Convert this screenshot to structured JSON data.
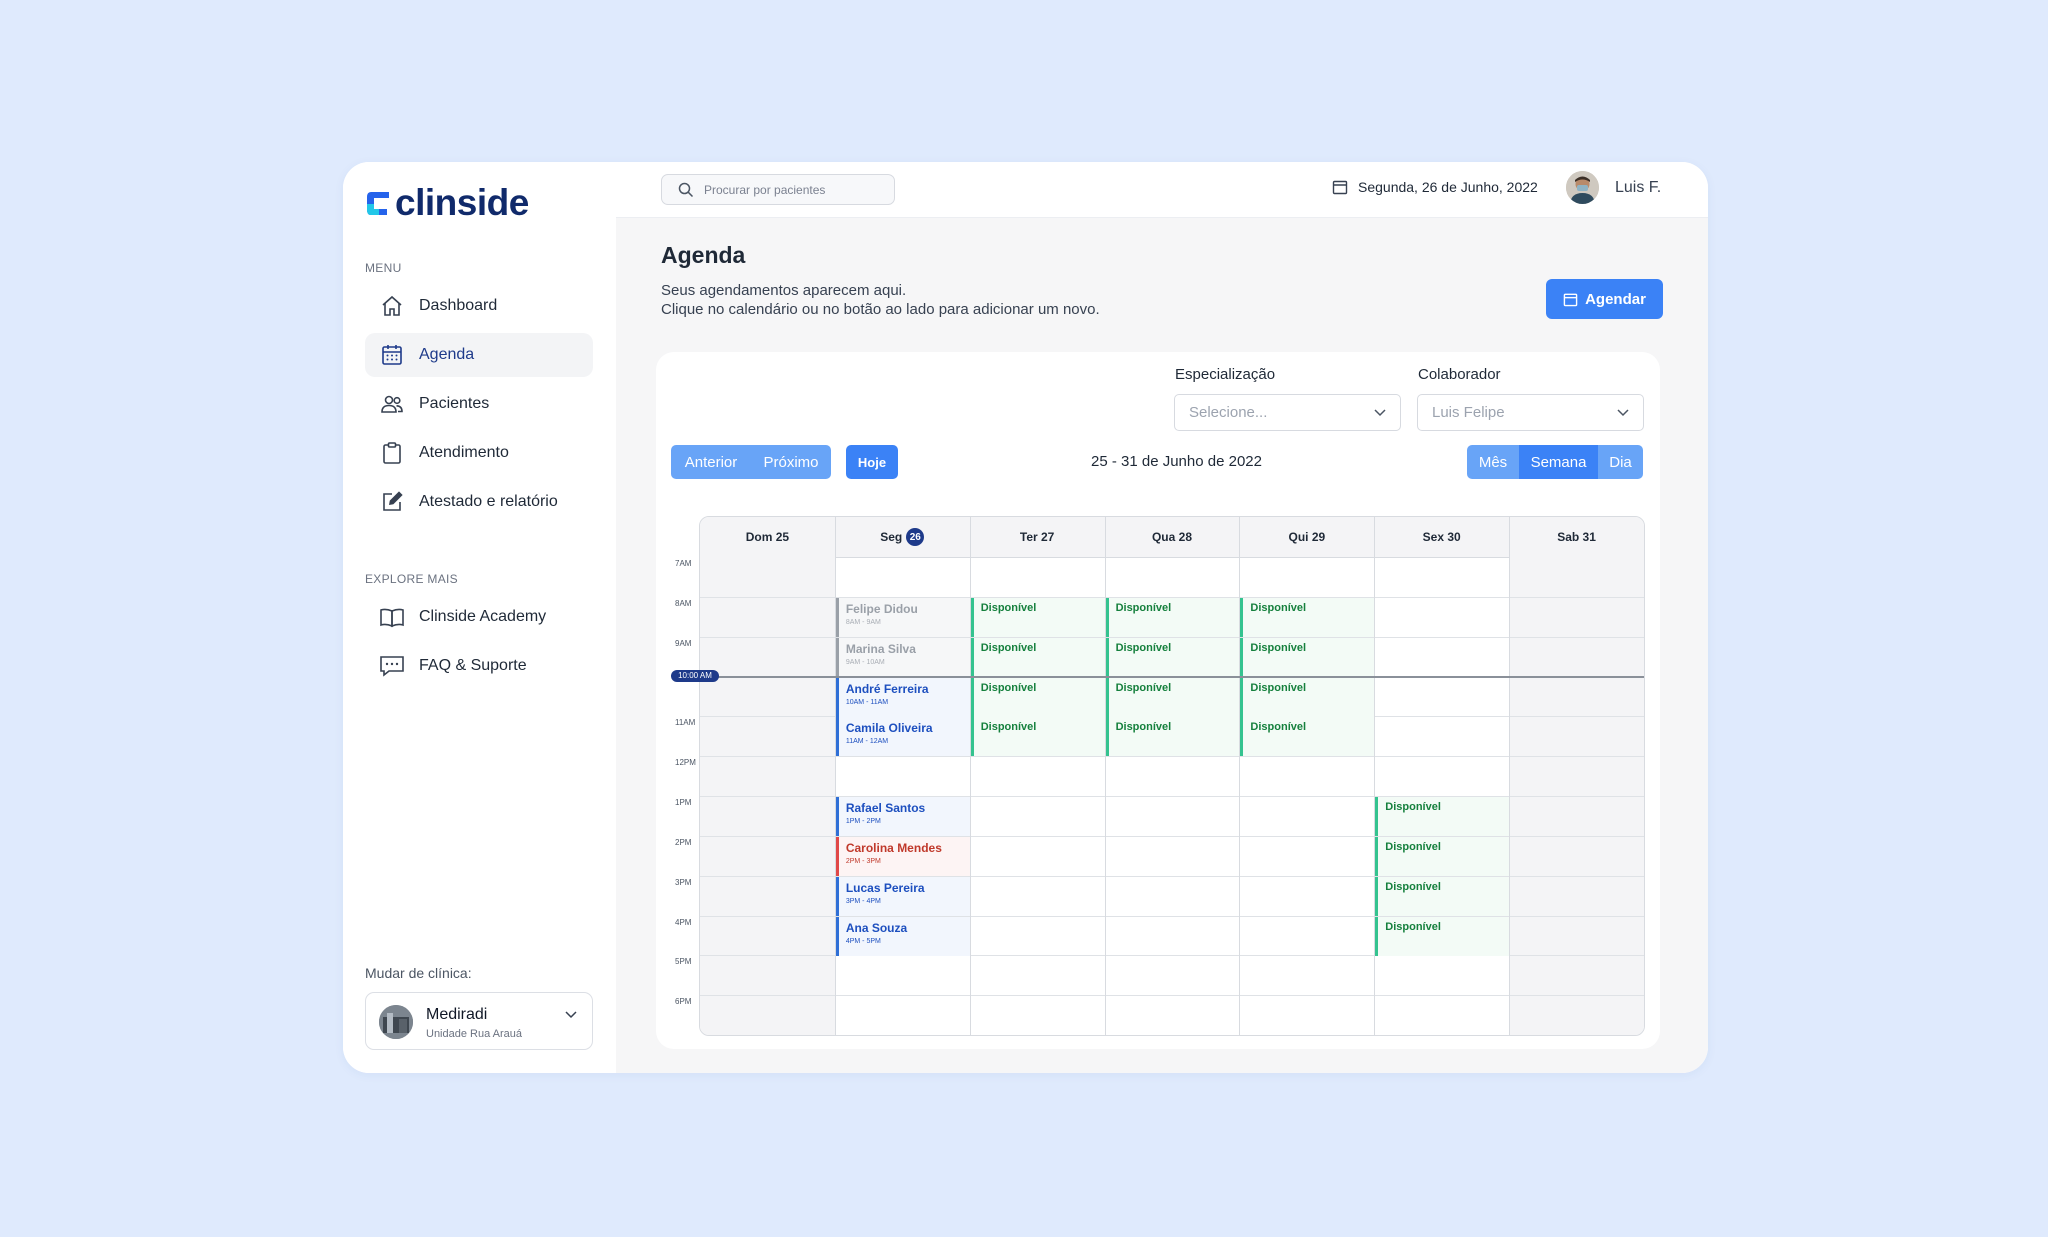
{
  "brand": {
    "name": "clinside"
  },
  "sidebar": {
    "menu_label": "MENU",
    "items": [
      {
        "label": "Dashboard",
        "icon": "home-icon"
      },
      {
        "label": "Agenda",
        "icon": "calendar-grid-icon",
        "active": true
      },
      {
        "label": "Pacientes",
        "icon": "users-icon"
      },
      {
        "label": "Atendimento",
        "icon": "clipboard-icon"
      },
      {
        "label": "Atestado e relatório",
        "icon": "edit-document-icon"
      }
    ],
    "explore_label": "EXPLORE MAIS",
    "explore_items": [
      {
        "label": "Clinside Academy",
        "icon": "book-icon"
      },
      {
        "label": "FAQ & Suporte",
        "icon": "chat-icon"
      }
    ],
    "clinic_switch_label": "Mudar de clínica:",
    "clinic": {
      "name": "Mediradi",
      "unit": "Unidade Rua Arauá"
    }
  },
  "topbar": {
    "search_placeholder": "Procurar por pacientes",
    "date": "Segunda, 26 de Junho, 2022",
    "user_name": "Luis F."
  },
  "page": {
    "title": "Agenda",
    "description_line1": "Seus agendamentos aparecem aqui.",
    "description_line2": "Clique no calendário ou no botão ao lado para adicionar um novo.",
    "schedule_button": "Agendar"
  },
  "filters": {
    "specialization_label": "Especialização",
    "specialization_value": "Selecione...",
    "collaborator_label": "Colaborador",
    "collaborator_value": "Luis Felipe"
  },
  "toolbar": {
    "prev": "Anterior",
    "next": "Próximo",
    "today": "Hoje",
    "range": "25 - 31 de Junho de 2022",
    "views": [
      "Mês",
      "Semana",
      "Dia"
    ],
    "active_view": "Semana"
  },
  "calendar": {
    "days": [
      {
        "label": "Dom 25",
        "weekend": true
      },
      {
        "label": "Seg",
        "badge": "26",
        "today": true
      },
      {
        "label": "Ter 27"
      },
      {
        "label": "Qua 28"
      },
      {
        "label": "Qui 29"
      },
      {
        "label": "Sex 30"
      },
      {
        "label": "Sab 31",
        "weekend": true
      }
    ],
    "hours": [
      "7AM",
      "8AM",
      "9AM",
      "10AM",
      "11AM",
      "12PM",
      "1PM",
      "2PM",
      "3PM",
      "4PM",
      "5PM",
      "6PM"
    ],
    "now_label": "10:00 AM",
    "now_hour": 10,
    "events": [
      {
        "day": 1,
        "hour": 8,
        "title": "Felipe Didou",
        "time": "8AM - 9AM",
        "style": "gray"
      },
      {
        "day": 1,
        "hour": 9,
        "title": "Marina Silva",
        "time": "9AM - 10AM",
        "style": "gray"
      },
      {
        "day": 1,
        "hour": 10,
        "title": "André Ferreira",
        "time": "10AM - 11AM",
        "style": "blue"
      },
      {
        "day": 1,
        "hour": 11,
        "title": "Camila Oliveira",
        "time": "11AM - 12AM",
        "style": "blue"
      },
      {
        "day": 1,
        "hour": 13,
        "title": "Rafael Santos",
        "time": "1PM - 2PM",
        "style": "blue"
      },
      {
        "day": 1,
        "hour": 14,
        "title": "Carolina Mendes",
        "time": "2PM - 3PM",
        "style": "red"
      },
      {
        "day": 1,
        "hour": 15,
        "title": "Lucas Pereira",
        "time": "3PM - 4PM",
        "style": "blue"
      },
      {
        "day": 1,
        "hour": 16,
        "title": "Ana Souza",
        "time": "4PM - 5PM",
        "style": "blue"
      },
      {
        "day": 2,
        "hour": 8,
        "title": "Disponível",
        "style": "green"
      },
      {
        "day": 2,
        "hour": 9,
        "title": "Disponível",
        "style": "green"
      },
      {
        "day": 2,
        "hour": 10,
        "title": "Disponível",
        "style": "green"
      },
      {
        "day": 2,
        "hour": 11,
        "title": "Disponível",
        "style": "green"
      },
      {
        "day": 3,
        "hour": 8,
        "title": "Disponível",
        "style": "green"
      },
      {
        "day": 3,
        "hour": 9,
        "title": "Disponível",
        "style": "green"
      },
      {
        "day": 3,
        "hour": 10,
        "title": "Disponível",
        "style": "green"
      },
      {
        "day": 3,
        "hour": 11,
        "title": "Disponível",
        "style": "green"
      },
      {
        "day": 4,
        "hour": 8,
        "title": "Disponível",
        "style": "green"
      },
      {
        "day": 4,
        "hour": 9,
        "title": "Disponível",
        "style": "green"
      },
      {
        "day": 4,
        "hour": 10,
        "title": "Disponível",
        "style": "green"
      },
      {
        "day": 4,
        "hour": 11,
        "title": "Disponível",
        "style": "green"
      },
      {
        "day": 5,
        "hour": 13,
        "title": "Disponível",
        "style": "green"
      },
      {
        "day": 5,
        "hour": 14,
        "title": "Disponível",
        "style": "green"
      },
      {
        "day": 5,
        "hour": 15,
        "title": "Disponível",
        "style": "green"
      },
      {
        "day": 5,
        "hour": 16,
        "title": "Disponível",
        "style": "green"
      }
    ]
  },
  "colors": {
    "accent": "#3b82f6",
    "accent_light": "#68a4f7",
    "brand_navy": "#102a6b",
    "available": "#34c38f",
    "busy": "#2f6fd6",
    "alert": "#e04848"
  }
}
